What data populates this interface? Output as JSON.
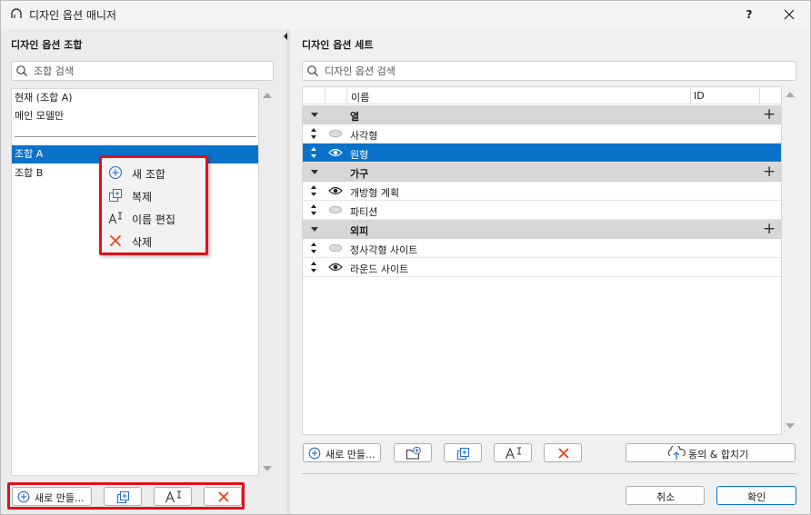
{
  "window": {
    "title": "디자인 옵션 매니저",
    "help_label": "?"
  },
  "left": {
    "heading": "디자인 옵션 조합",
    "search_placeholder": "조합 검색",
    "fixed_items": [
      "현재 (조합 A)",
      "메인 모델만"
    ],
    "combos": [
      "조합 A",
      "조합 B"
    ],
    "selected_combo": "조합 A",
    "buttons": {
      "new_label": "새로 만들..."
    }
  },
  "context_menu": {
    "items": [
      {
        "label": "새 조합",
        "icon": "add-circle-icon"
      },
      {
        "label": "복제",
        "icon": "duplicate-icon"
      },
      {
        "label": "이름 편집",
        "icon": "rename-icon"
      },
      {
        "label": "삭제",
        "icon": "delete-x-icon"
      }
    ]
  },
  "right": {
    "heading": "디자인 옵션 세트",
    "search_placeholder": "디자인 옵션 검색",
    "columns": {
      "name": "이름",
      "id": "ID"
    },
    "groups": [
      {
        "label": "열",
        "rows": [
          {
            "label": "사각형",
            "visible": false,
            "selected": false
          },
          {
            "label": "원형",
            "visible": true,
            "selected": true
          }
        ]
      },
      {
        "label": "가구",
        "rows": [
          {
            "label": "개방형 계획",
            "visible": true,
            "selected": false
          },
          {
            "label": "파티션",
            "visible": false,
            "selected": false
          }
        ]
      },
      {
        "label": "외피",
        "rows": [
          {
            "label": "정사각형 사이트",
            "visible": false,
            "selected": false
          },
          {
            "label": "라운드 사이트",
            "visible": true,
            "selected": false
          }
        ]
      }
    ],
    "buttons": {
      "new_label": "새로 만들...",
      "merge_label": "동의 & 합치기"
    }
  },
  "footer": {
    "cancel_label": "취소",
    "ok_label": "확인"
  },
  "colors": {
    "selection": "#0a72c9",
    "highlight_border": "#e0101a",
    "delete_x": "#e8421a",
    "add_blue": "#2b6fc0"
  }
}
